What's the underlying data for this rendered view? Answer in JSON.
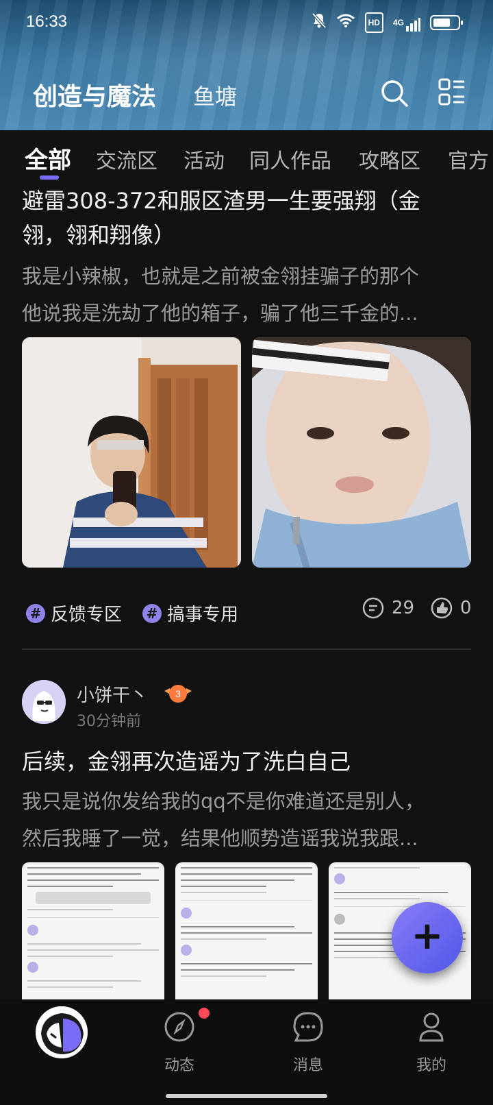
{
  "status_bar": {
    "time": "16:33",
    "hd": "HD",
    "network": "4G"
  },
  "header": {
    "title": "创造与魔法",
    "subtitle": "鱼塘",
    "icons": [
      "search-icon",
      "menu-grid-icon"
    ]
  },
  "tabs": [
    {
      "label": "全部",
      "active": true
    },
    {
      "label": "交流区"
    },
    {
      "label": "活动"
    },
    {
      "label": "同人作品"
    },
    {
      "label": "攻略区"
    },
    {
      "label": "官方"
    }
  ],
  "posts": [
    {
      "title": "避雷308-372和服区渣男一生要强翔（金翎，翎和翔像）",
      "title_line1": "避雷308-372和服区渣男一生要强翔（金",
      "title_line2": "翎，翎和翔像）",
      "excerpt_line1": "我是小辣椒，也就是之前被金翎挂骗子的那个",
      "excerpt_line2": "他说我是洗劫了他的箱子，骗了他三千金的...",
      "tags": [
        "反馈专区",
        "搞事专用"
      ],
      "comments": "29",
      "likes": "0"
    },
    {
      "author": "小饼干丶",
      "level": "3",
      "time": "30分钟前",
      "title": "后续，金翎再次造谣为了洗白自己",
      "excerpt_line1": "我只是说你发给我的qq不是你难道还是别人，",
      "excerpt_line2": "然后我睡了一觉，结果他顺势造谣我说我跟..."
    }
  ],
  "fab": "+",
  "bottom_nav": [
    {
      "label": "",
      "icon": "home-avatar-icon"
    },
    {
      "label": "动态",
      "icon": "compass-icon",
      "badge": true
    },
    {
      "label": "消息",
      "icon": "chat-icon"
    },
    {
      "label": "我的",
      "icon": "person-icon"
    }
  ],
  "colors": {
    "accent": "#7b6cf6",
    "background": "#121212",
    "badge": "#ff4a5a"
  }
}
